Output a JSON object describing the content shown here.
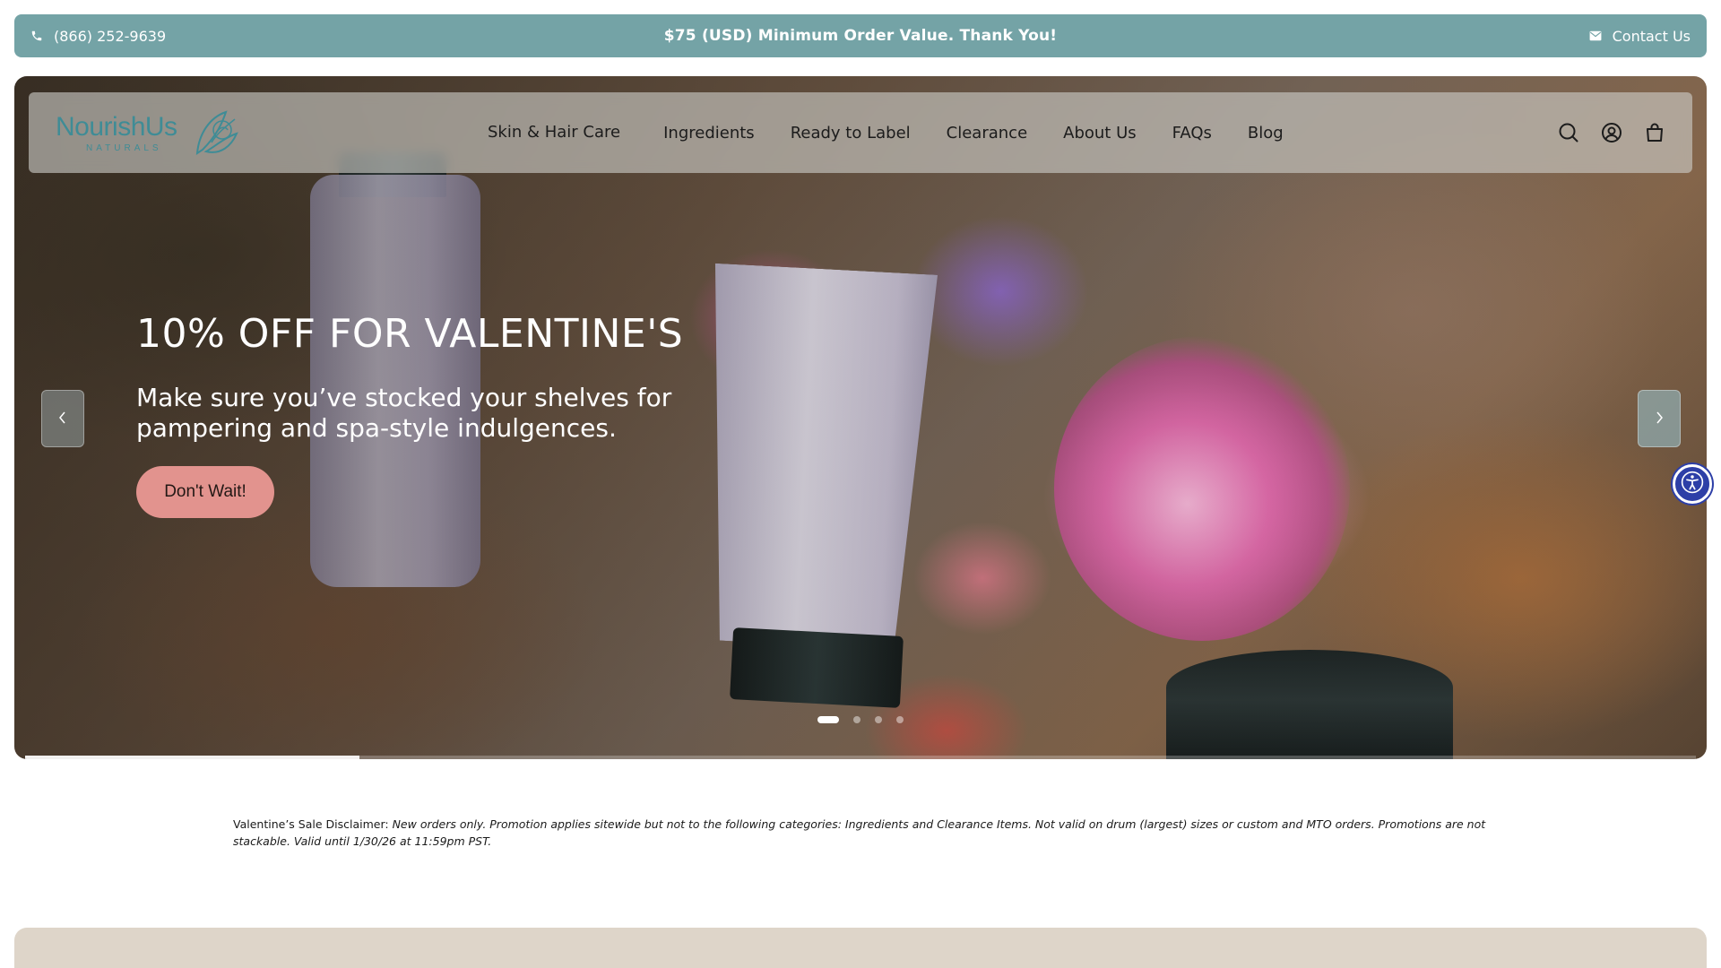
{
  "announcement": {
    "phone": "(866) 252-9639",
    "message": "$75 (USD) Minimum Order Value. Thank You!",
    "contact_label": "Contact Us",
    "phone_icon": "phone-icon",
    "contact_icon": "mail-icon"
  },
  "brand": {
    "name": "NourishUs",
    "tagline": "NATURALS",
    "logo_icon": "leaf-emblem-icon",
    "color": "#3f8c96"
  },
  "nav": {
    "items": [
      {
        "label": "Skin & Hair Care"
      },
      {
        "label": "Ingredients"
      },
      {
        "label": "Ready to Label"
      },
      {
        "label": "Clearance"
      },
      {
        "label": "About Us"
      },
      {
        "label": "FAQs"
      },
      {
        "label": "Blog"
      }
    ],
    "icons": [
      "search-icon",
      "account-icon",
      "cart-icon"
    ]
  },
  "hero": {
    "title": "10% OFF FOR VALENTINE'S",
    "text": "Make sure you’ve stocked your shelves for pampering and spa-style indulgences.",
    "cta_label": "Don't Wait!",
    "cta_color": "#e2938e",
    "prev_icon": "chevron-left-icon",
    "next_icon": "chevron-right-icon",
    "slides_total": 4,
    "active_slide": 1,
    "progress": 0.2
  },
  "accessibility": {
    "icon": "accessibility-icon",
    "color": "#2d3fa7"
  },
  "disclaimer": {
    "label": "Valentine’s Sale Disclaimer:",
    "text": "New orders only. Promotion applies sitewide but not to the following categories: Ingredients and Clearance Items. Not valid on drum (largest) sizes or custom and MTO orders. Promotions are not stackable. Valid until 1/30/26 at 11:59pm PST."
  },
  "colors": {
    "announcement_bg": "#74a3a6",
    "bottom_band": "#ded5c9"
  }
}
